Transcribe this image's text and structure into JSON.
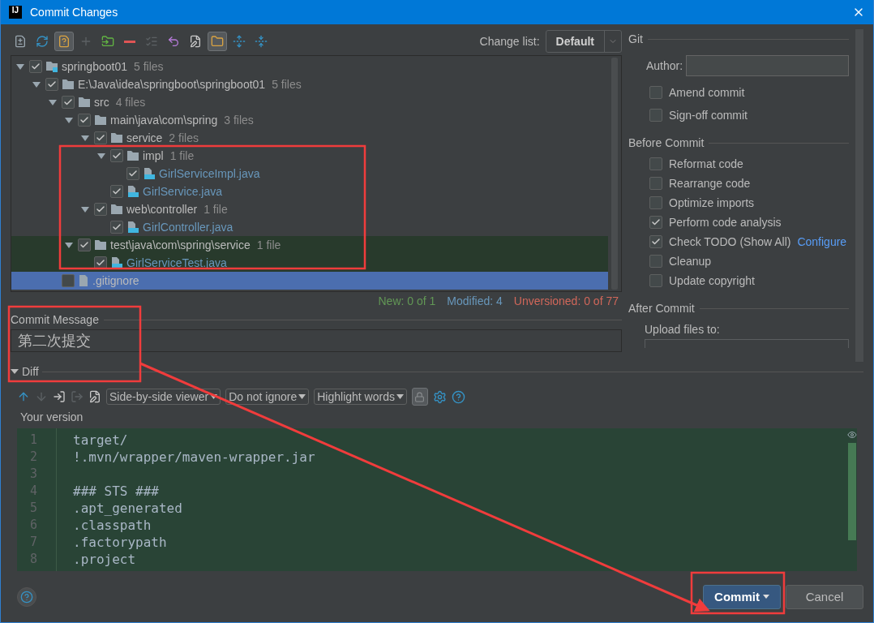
{
  "window": {
    "icon_label": "IJ",
    "title": "Commit Changes"
  },
  "toolbar": [
    {
      "kind": "diff",
      "pressed": false,
      "disabled": false
    },
    {
      "kind": "refresh",
      "pressed": false,
      "disabled": false
    },
    {
      "kind": "unversioned",
      "pressed": true,
      "disabled": false
    },
    {
      "kind": "add",
      "pressed": false,
      "disabled": true
    },
    {
      "kind": "move",
      "pressed": false,
      "disabled": false
    },
    {
      "kind": "remove",
      "pressed": false,
      "disabled": false
    },
    {
      "kind": "checklist",
      "pressed": false,
      "disabled": true
    },
    {
      "kind": "revert",
      "pressed": false,
      "disabled": false
    },
    {
      "kind": "edit",
      "pressed": false,
      "disabled": false
    },
    {
      "kind": "group",
      "pressed": true,
      "disabled": false
    },
    {
      "kind": "expand",
      "pressed": false,
      "disabled": false
    },
    {
      "kind": "collapse",
      "pressed": false,
      "disabled": false
    }
  ],
  "change_list": {
    "label": "Change list:",
    "value": "Default"
  },
  "tree": [
    {
      "label": "springboot01",
      "count": "5 files",
      "kind": "module",
      "checked": true,
      "expanded": true,
      "selected": false,
      "highlighted": false,
      "children": [
        {
          "label": "E:\\Java\\idea\\springboot\\springboot01",
          "count": "5 files",
          "kind": "folder",
          "checked": true,
          "expanded": true,
          "selected": false,
          "highlighted": false,
          "children": [
            {
              "label": "src",
              "count": "4 files",
              "kind": "folder",
              "checked": true,
              "expanded": true,
              "selected": false,
              "highlighted": false,
              "children": [
                {
                  "label": "main\\java\\com\\spring",
                  "count": "3 files",
                  "kind": "folder",
                  "checked": true,
                  "expanded": true,
                  "selected": false,
                  "highlighted": false,
                  "children": [
                    {
                      "label": "service",
                      "count": "2 files",
                      "kind": "folder",
                      "checked": true,
                      "expanded": true,
                      "selected": false,
                      "highlighted": false,
                      "children": [
                        {
                          "label": "impl",
                          "count": "1 file",
                          "kind": "folder",
                          "checked": true,
                          "expanded": true,
                          "selected": false,
                          "highlighted": false,
                          "children": [
                            {
                              "label": "GirlServiceImpl.java",
                              "kind": "java",
                              "checked": true,
                              "selected": false,
                              "highlighted": false
                            }
                          ]
                        },
                        {
                          "label": "GirlService.java",
                          "kind": "java",
                          "checked": true,
                          "selected": false,
                          "highlighted": false
                        }
                      ]
                    },
                    {
                      "label": "web\\controller",
                      "count": "1 file",
                      "kind": "folder",
                      "checked": true,
                      "expanded": true,
                      "selected": false,
                      "highlighted": false,
                      "children": [
                        {
                          "label": "GirlController.java",
                          "kind": "java",
                          "checked": true,
                          "selected": false,
                          "highlighted": false
                        }
                      ]
                    }
                  ]
                },
                {
                  "label": "test\\java\\com\\spring\\service",
                  "count": "1 file",
                  "kind": "folder",
                  "checked": true,
                  "expanded": true,
                  "selected": false,
                  "highlighted": true,
                  "children": [
                    {
                      "label": "GirlServiceTest.java",
                      "kind": "java",
                      "checked": true,
                      "selected": false,
                      "highlighted": true
                    }
                  ]
                }
              ]
            },
            {
              "label": ".gitignore",
              "kind": "file",
              "checked": false,
              "selected": true,
              "highlighted": false
            }
          ]
        }
      ]
    }
  ],
  "status": [
    {
      "text": "New: 0 of 1",
      "color": "#629755"
    },
    {
      "text": "Modified: 4",
      "color": "#6897bb"
    },
    {
      "text": "Unversioned: 0 of 77",
      "color": "#d1675a"
    }
  ],
  "commit_message": {
    "title": "Commit Message",
    "value": "第二次提交"
  },
  "git": {
    "title": "Git",
    "author_label": "Author:",
    "options": [
      {
        "label": "Amend commit",
        "checked": false
      },
      {
        "label": "Sign-off commit",
        "checked": false
      }
    ]
  },
  "before_commit": {
    "title": "Before Commit",
    "options": [
      {
        "label": "Reformat code",
        "checked": false
      },
      {
        "label": "Rearrange code",
        "checked": false
      },
      {
        "label": "Optimize imports",
        "checked": false
      },
      {
        "label": "Perform code analysis",
        "checked": true
      },
      {
        "label": "Check TODO (Show All)",
        "checked": true,
        "link": "Configure"
      },
      {
        "label": "Cleanup",
        "checked": false
      },
      {
        "label": "Update copyright",
        "checked": false
      }
    ]
  },
  "after_commit": {
    "title": "After Commit",
    "upload_label": "Upload files to:"
  },
  "diff": {
    "title": "Diff",
    "expanded": true,
    "tools": [
      {
        "kind": "prev",
        "disabled": false
      },
      {
        "kind": "next",
        "disabled": true
      },
      {
        "kind": "jump",
        "disabled": false
      },
      {
        "kind": "jump-other",
        "disabled": true
      },
      {
        "kind": "edit",
        "disabled": false
      }
    ],
    "dropdowns": [
      "Side-by-side viewer",
      "Do not ignore",
      "Highlight words"
    ],
    "locked": true,
    "version_label": "Your version",
    "lines": [
      {
        "number": "1",
        "text": "target/"
      },
      {
        "number": "2",
        "text": "!.mvn/wrapper/maven-wrapper.jar"
      },
      {
        "number": "3"
      },
      {
        "number": "4",
        "text": "### STS ###"
      },
      {
        "number": "5",
        "text": ".apt_generated"
      },
      {
        "number": "6",
        "text": ".classpath"
      },
      {
        "number": "7",
        "text": ".factorypath"
      },
      {
        "number": "8",
        "text": ".project"
      }
    ]
  },
  "buttons": [
    {
      "label": "Commit",
      "kind": "primary"
    },
    {
      "label": "Cancel",
      "kind": "secondary"
    }
  ]
}
